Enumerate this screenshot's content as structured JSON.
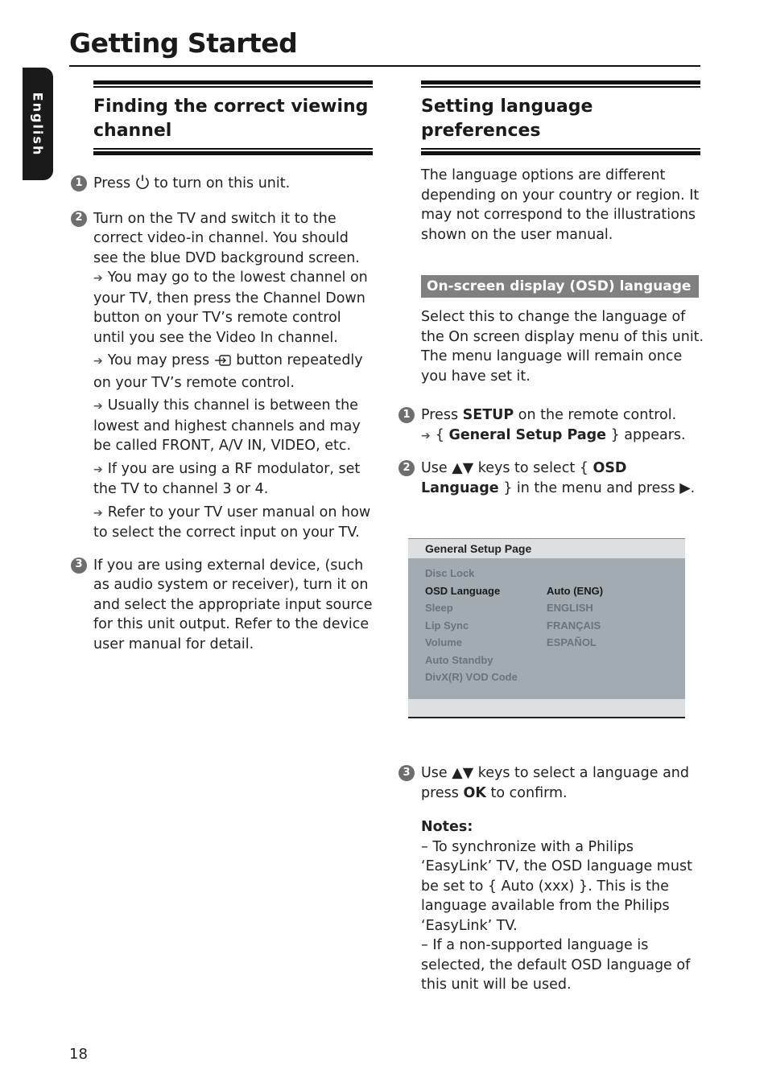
{
  "header": {
    "title": "Getting Started",
    "side_tab": "English"
  },
  "left": {
    "title": "Finding the correct viewing channel",
    "steps": [
      {
        "num": "1",
        "pre": "Press",
        "icon": "power-icon",
        "post": "to turn on this unit."
      },
      {
        "num": "2",
        "text": "Turn on the TV and switch it to the correct video-in channel. You should see the blue DVD background screen.",
        "subs": [
          "You may go to the lowest channel on your TV, then press the Channel Down button on your TV’s remote control until you see the Video In channel.",
          {
            "pre": "You may press",
            "icon": "input-source-icon",
            "post": "button repeatedly on your TV’s remote control."
          },
          "Usually this channel is between the lowest and highest channels and may be called FRONT, A/V IN, VIDEO, etc.",
          "If you are using a RF modulator, set the TV to channel 3 or 4.",
          "Refer to your TV user manual on how to select the correct input on your TV."
        ]
      },
      {
        "num": "3",
        "text": "If you are using external device, (such as audio system or receiver), turn it on and select the appropriate input source for this unit output. Refer to the device user manual for detail."
      }
    ]
  },
  "right": {
    "title": "Setting language preferences",
    "intro": "The language options are different depending on your country or region. It may not correspond to the illustrations shown on the user manual.",
    "osd_heading": "On-screen display (OSD) language",
    "osd_desc": "Select this to change the language of the On screen display menu of this unit. The menu language will remain once you have set it.",
    "step1": {
      "num": "1",
      "pre": "Press",
      "bold": "SETUP",
      "post": "on the remote control.",
      "sub_pre": "{",
      "sub_bold": "General Setup Page",
      "sub_post": "} appears."
    },
    "step2": {
      "num": "2",
      "pre": "Use ▲▼ keys to select {",
      "bold": "OSD Language",
      "post": "} in the menu and press ▶."
    },
    "menu": {
      "title": "General Setup Page",
      "items": [
        "Disc Lock",
        "OSD Language",
        "Sleep",
        "Lip Sync",
        "Volume",
        "Auto Standby",
        "DivX(R) VOD Code"
      ],
      "selected_item": "OSD Language",
      "options": [
        "",
        "Auto (ENG)",
        "ENGLISH",
        "FRANÇAIS",
        "ESPAÑOL",
        "",
        ""
      ]
    },
    "step3": {
      "num": "3",
      "pre": "Use ▲▼ keys to select a language and press",
      "bold": "OK",
      "post": "to confirm."
    },
    "notes": {
      "title": "Notes:",
      "items": [
        "–  To synchronize with a Philips ‘EasyLink’ TV, the OSD language must be set to { Auto (xxx) }. This is the language available from the Philips ‘EasyLink’ TV.",
        "–  If a non-supported language is selected, the default OSD language of this unit will be used."
      ]
    }
  },
  "footer": {
    "page_number": "18"
  }
}
